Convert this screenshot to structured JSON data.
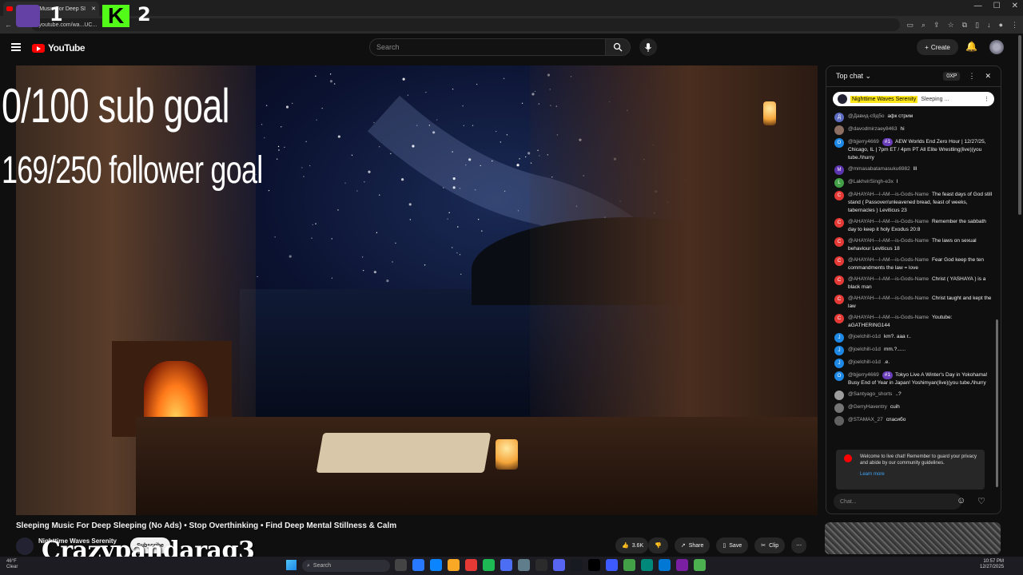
{
  "browser": {
    "tab_title": "Sleeping Music For Deep Sl",
    "url": "youtube.com/wa...UC..."
  },
  "overlay": {
    "twitch_number": "1",
    "kick_letter": "K",
    "kick_number": "2",
    "sub_goal": "0/100 sub goal",
    "follower_goal": "169/250 follower goal",
    "streamer_name": "Crazypandarag3"
  },
  "header": {
    "logo": "YouTube",
    "search_placeholder": "Search",
    "create_label": "Create"
  },
  "video": {
    "title": "Sleeping Music For Deep Sleeping (No Ads) • Stop Overthinking • Find Deep Mental Stillness & Calm",
    "channel": "Nighttime Waves Serenity",
    "subscribe_label": "Subscribe",
    "likes": "3.6K",
    "share_label": "Share",
    "save_label": "Save",
    "clip_label": "Clip"
  },
  "chat": {
    "header": "Top chat",
    "xp": "0XP",
    "pinned_channel": "Nighttime Waves Serenity",
    "pinned_text": "Sleeping ...",
    "messages": [
      {
        "initial": "Д",
        "color": "#5c6bc0",
        "author": "@Давид-с9д5о",
        "badge": "",
        "text": "афк стрим"
      },
      {
        "initial": "",
        "color": "#8d6e63",
        "author": "@davodmirzaey8463",
        "badge": "",
        "text": "hi"
      },
      {
        "initial": "O",
        "color": "#1e88e5",
        "author": "@bjjerry4669",
        "badge": "#1",
        "text": "AEW Worlds End Zero Hour | 12/27/25, Chicago, IL | 7pm ET / 4pm PT All Elite Wrestling(live)(you tube./\\hurry"
      },
      {
        "initial": "M",
        "color": "#5e35b1",
        "author": "@mmasabatamasuku6982",
        "badge": "",
        "text": "lll"
      },
      {
        "initial": "L",
        "color": "#43a047",
        "author": "@LakhvirSingh-e3x",
        "badge": "",
        "text": "l"
      },
      {
        "initial": "C",
        "color": "#e53935",
        "author": "@AHAYAH---I-AM---is-Gods-Name",
        "badge": "",
        "text": "The feast days of God still stand ( Passover/unleavened bread, feast of weeks, tabernacles ) Leviticus 23"
      },
      {
        "initial": "C",
        "color": "#e53935",
        "author": "@AHAYAH---I-AM---is-Gods-Name",
        "badge": "",
        "text": "Remember the sabbath day to keep it holy Exodus 20:8"
      },
      {
        "initial": "C",
        "color": "#e53935",
        "author": "@AHAYAH---I-AM---is-Gods-Name",
        "badge": "",
        "text": "The laws on sexual behaviour Leviticus 18"
      },
      {
        "initial": "C",
        "color": "#e53935",
        "author": "@AHAYAH---I-AM---is-Gods-Name",
        "badge": "",
        "text": "Fear God keep the ten commandments the law = love"
      },
      {
        "initial": "C",
        "color": "#e53935",
        "author": "@AHAYAH---I-AM---is-Gods-Name",
        "badge": "",
        "text": "Christ ( YASHAYA ) is a black man"
      },
      {
        "initial": "C",
        "color": "#e53935",
        "author": "@AHAYAH---I-AM---is-Gods-Name",
        "badge": "",
        "text": "Christ taught and kept the law"
      },
      {
        "initial": "C",
        "color": "#e53935",
        "author": "@AHAYAH---I-AM---is-Gods-Name",
        "badge": "",
        "text": "Youtube: aGATHERING144"
      },
      {
        "initial": "J",
        "color": "#1e88e5",
        "author": "@joelchill-o1d",
        "badge": "",
        "text": "km?. aaa r.."
      },
      {
        "initial": "J",
        "color": "#1e88e5",
        "author": "@joelchill-o1d",
        "badge": "",
        "text": "mm.?......"
      },
      {
        "initial": "J",
        "color": "#1e88e5",
        "author": "@joelchill-o1d",
        "badge": "",
        "text": ".e."
      },
      {
        "initial": "O",
        "color": "#1e88e5",
        "author": "@bjjerry4669",
        "badge": "#1",
        "text": "Tokyo Live A Winter's Day in Yokohama! Busy End of Year in Japan! Yoshimyan(live)(you tube./\\hurry"
      },
      {
        "initial": "",
        "color": "#9e9e9e",
        "author": "@Santyago_shorts",
        "badge": "",
        "text": "..?"
      },
      {
        "initial": "",
        "color": "#757575",
        "author": "@GerryHaventry",
        "badge": "",
        "text": "cuih"
      },
      {
        "initial": "",
        "color": "#616161",
        "author": "@STAMAX_27",
        "badge": "",
        "text": "спасибо"
      }
    ],
    "welcome": "Welcome to live chat! Remember to guard your privacy and abide by our community guidelines.",
    "learn_more": "Learn more",
    "input_placeholder": "Chat..."
  },
  "taskbar": {
    "temp": "46°F",
    "condition": "Clear",
    "search": "Search",
    "time": "10:57 PM",
    "date": "12/27/2025"
  }
}
